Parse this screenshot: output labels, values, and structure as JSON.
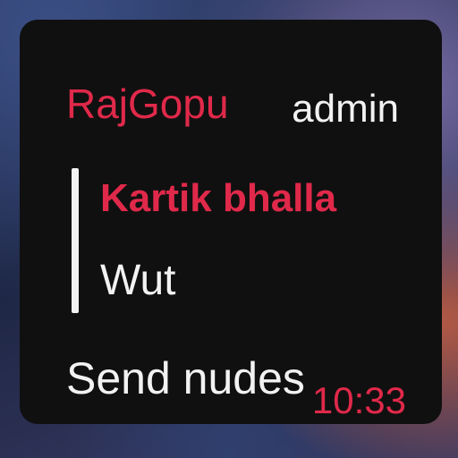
{
  "message": {
    "sender_name": "RajGopu",
    "sender_role": "admin",
    "reply": {
      "author": "Kartik bhalla",
      "text": "Wut"
    },
    "text": "Send nudes",
    "time": "10:33"
  },
  "colors": {
    "accent": "#e0294a",
    "bubble_background": "#101010",
    "text": "#f2f2f2"
  }
}
